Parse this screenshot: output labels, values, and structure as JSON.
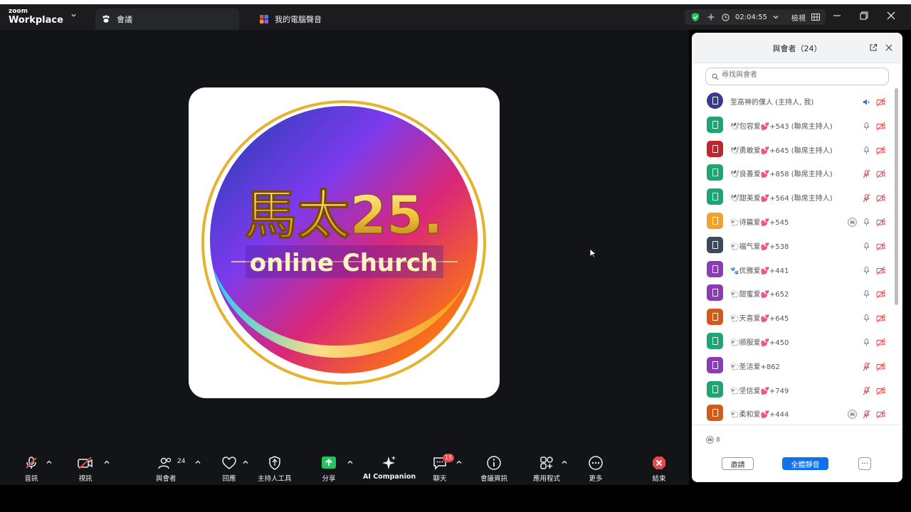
{
  "app": {
    "logo_small": "zoom",
    "logo_big": "Workplace"
  },
  "tabs": [
    {
      "label": "會議",
      "icon": "paw-icon"
    },
    {
      "label": "我的電腦聲音",
      "icon": "sound-app-icon"
    }
  ],
  "topbar": {
    "timer": "02:04:55",
    "view_label": "檢視"
  },
  "stage": {
    "title_line1": "馬太25.",
    "title_line2": "online Church"
  },
  "panel": {
    "title": "與會者（24）",
    "search_placeholder": "尋找與會者",
    "participants": [
      {
        "name": "至高神的僕人 (主持人, 我)",
        "avatar_color": "#3a3a8c",
        "hand": false,
        "mic": "speaking",
        "video": "off"
      },
      {
        "name": "🕊包容爱💕+543 (聯席主持人)",
        "avatar_color": "#1da672",
        "hand": false,
        "mic": "on",
        "video": "off"
      },
      {
        "name": "🕊勇敢爱💕+645 (聯席主持人)",
        "avatar_color": "#c0262d",
        "hand": false,
        "mic": "on",
        "video": "off"
      },
      {
        "name": "🕊良善爱💕+858 (聯席主持人)",
        "avatar_color": "#1da672",
        "hand": false,
        "mic": "muted",
        "video": "off"
      },
      {
        "name": "🕊甜美爱💕+564 (聯席主持人)",
        "avatar_color": "#1da672",
        "hand": false,
        "mic": "muted",
        "video": "off"
      },
      {
        "name": "🐑诗篇爱💕+545",
        "avatar_color": "#f2a12c",
        "hand": true,
        "mic": "on",
        "video": "off"
      },
      {
        "name": "🐑福气爱💕+538",
        "avatar_color": "#3d4a5c",
        "hand": false,
        "mic": "on",
        "video": "off"
      },
      {
        "name": "🐾优雅爱💕+441",
        "avatar_color": "#8c3ab5",
        "hand": false,
        "mic": "on",
        "video": "off"
      },
      {
        "name": "🐑甜蜜爱💕+652",
        "avatar_color": "#8c3ab5",
        "hand": false,
        "mic": "on",
        "video": "off"
      },
      {
        "name": "🐑天喜爱💕+645",
        "avatar_color": "#d65a17",
        "hand": false,
        "mic": "on",
        "video": "off"
      },
      {
        "name": "🐑顺服爱💕+450",
        "avatar_color": "#1da672",
        "hand": false,
        "mic": "on",
        "video": "off"
      },
      {
        "name": "🐑圣洁爱+862",
        "avatar_color": "#8c3ab5",
        "hand": false,
        "mic": "muted",
        "video": "off"
      },
      {
        "name": "🐑坚信爱💕+749",
        "avatar_color": "#1da672",
        "hand": false,
        "mic": "muted",
        "video": "off"
      },
      {
        "name": "🐑柔和爱💕+444",
        "avatar_color": "#d65a17",
        "hand": true,
        "mic": "muted",
        "video": "off"
      }
    ],
    "raised_count": "8",
    "invite_label": "邀請",
    "mute_all_label": "全體靜音",
    "more_label": "···"
  },
  "toolbar": {
    "audio": "音訊",
    "video": "視訊",
    "participants": "與會者",
    "participants_count": "24",
    "reactions": "回應",
    "host_tools": "主持人工具",
    "share": "分享",
    "ai": "AI Companion",
    "chat": "聊天",
    "chat_badge": "15",
    "info": "會議資訊",
    "apps": "應用程式",
    "more": "更多",
    "end": "結束"
  },
  "colors": {
    "accent": "#0e72ed",
    "share_green": "#22c55e",
    "end_red": "#e5484d",
    "muted_red": "#e5484d"
  }
}
